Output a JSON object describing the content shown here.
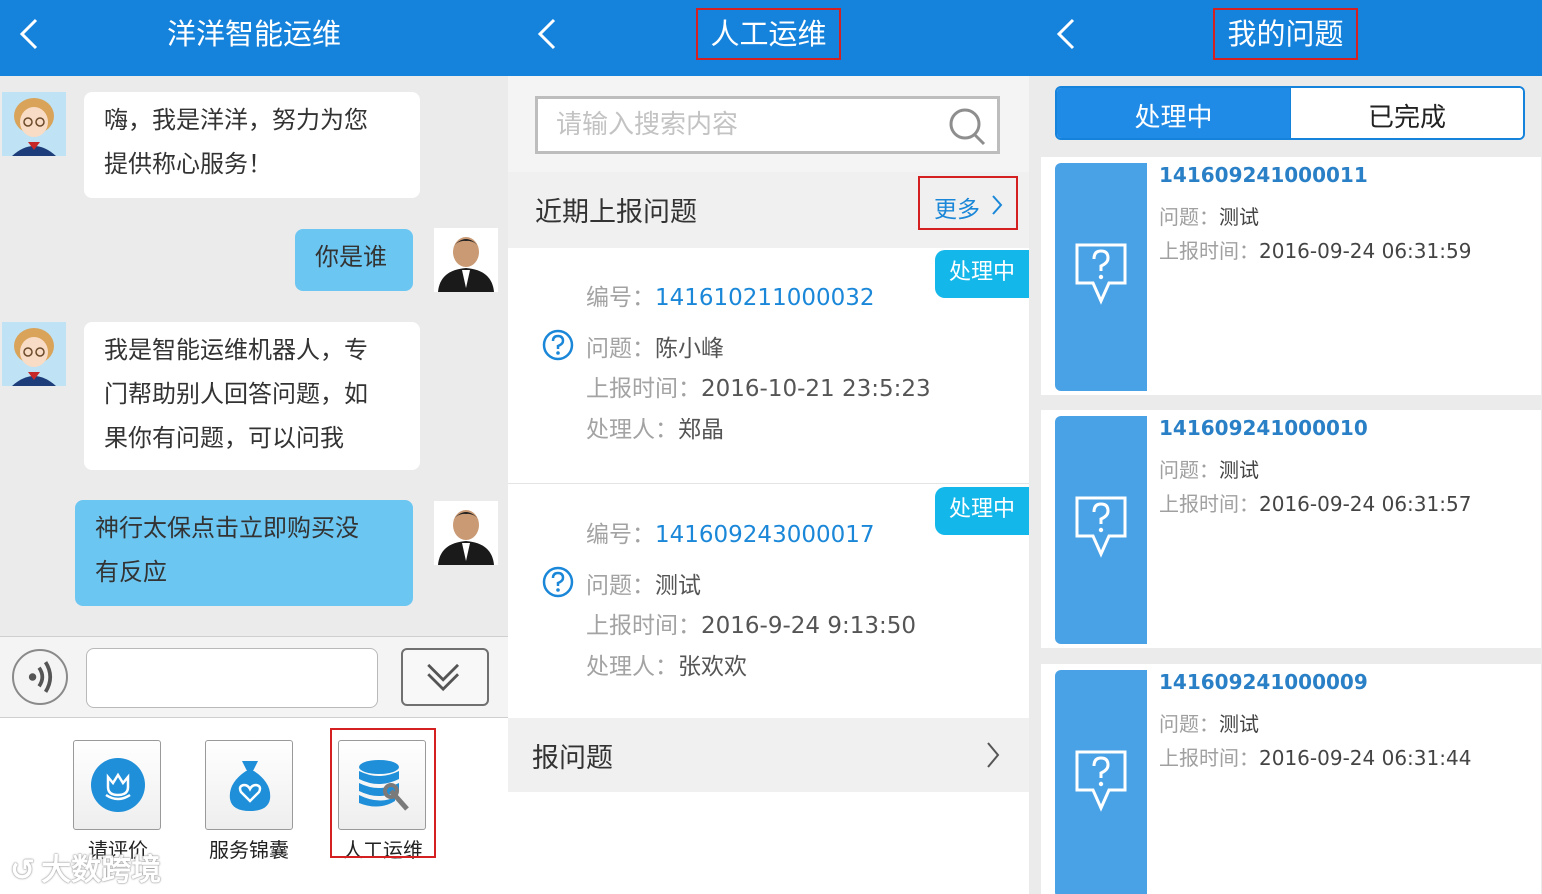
{
  "colors": {
    "topbar": "#1583dc",
    "accent": "#1a87d8",
    "badge": "#13b7ea",
    "highlight": "#d42020",
    "user_bubble": "#6cc6f2"
  },
  "watermark": "大数跨境",
  "panel1": {
    "title": "洋洋智能运维",
    "messages": [
      {
        "from": "bot",
        "lines": [
          "嗨，我是洋洋，努力为您",
          "提供称心服务！"
        ]
      },
      {
        "from": "user",
        "lines": [
          "你是谁"
        ]
      },
      {
        "from": "bot",
        "lines": [
          "我是智能运维机器人，专",
          "门帮助别人回答问题，如",
          "果你有问题，可以问我"
        ]
      },
      {
        "from": "user",
        "lines": [
          "神行太保点击立即购买没",
          "有反应"
        ]
      }
    ],
    "input": {
      "value": "",
      "placeholder": ""
    },
    "tools": [
      {
        "label": "请评价",
        "icon": "tulip-icon"
      },
      {
        "label": "服务锦囊",
        "icon": "bag-icon"
      },
      {
        "label": "人工运维",
        "icon": "database-wrench-icon"
      }
    ]
  },
  "panel2": {
    "title": "人工运维",
    "search": {
      "placeholder": "请输入搜索内容",
      "value": ""
    },
    "recent_title": "近期上报问题",
    "more_label": "更多",
    "labels": {
      "id": "编号：",
      "question": "问题：",
      "time": "上报时间：",
      "handler": "处理人："
    },
    "issues": [
      {
        "status": "处理中",
        "id": "141610211000032",
        "question": "陈小峰",
        "time": "2016-10-21 23:5:23",
        "handler": "郑晶"
      },
      {
        "status": "处理中",
        "id": "141609243000017",
        "question": "测试",
        "time": "2016-9-24 9:13:50",
        "handler": "张欢欢"
      }
    ],
    "report_label": "报问题"
  },
  "panel3": {
    "title": "我的问题",
    "tabs": [
      "处理中",
      "已完成"
    ],
    "labels": {
      "question": "问题：",
      "time": "上报时间："
    },
    "items": [
      {
        "id": "141609241000011",
        "question": "测试",
        "time": "2016-09-24 06:31:59"
      },
      {
        "id": "141609241000010",
        "question": "测试",
        "time": "2016-09-24 06:31:57"
      },
      {
        "id": "141609241000009",
        "question": "测试",
        "time": "2016-09-24 06:31:44"
      }
    ]
  }
}
